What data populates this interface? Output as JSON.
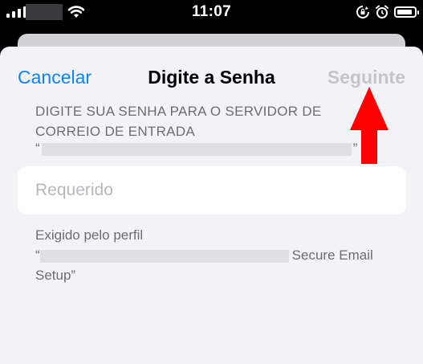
{
  "status_bar": {
    "time": "11:07"
  },
  "nav": {
    "cancel_label": "Cancelar",
    "title": "Digite a Senha",
    "next_label": "Seguinte"
  },
  "prompt": {
    "header": "DIGITE SUA SENHA PARA O SERVIDOR DE CORREIO DE ENTRADA",
    "open_quote": "“",
    "close_quote": "”"
  },
  "password_field": {
    "placeholder": "Requerido",
    "value": ""
  },
  "footer": {
    "line1": "Exigido pelo perfil",
    "open_quote": "“",
    "profile_suffix": "Secure Email",
    "line3": "Setup”"
  },
  "colors": {
    "accent": "#0a84ff",
    "disabled": "#c5c5c9",
    "annotation_arrow": "#ff0000"
  },
  "icons": [
    "signal-bars-icon",
    "wifi-icon",
    "screen-lock-rotation-icon",
    "alarm-icon",
    "battery-icon",
    "red-arrow-annotation"
  ]
}
